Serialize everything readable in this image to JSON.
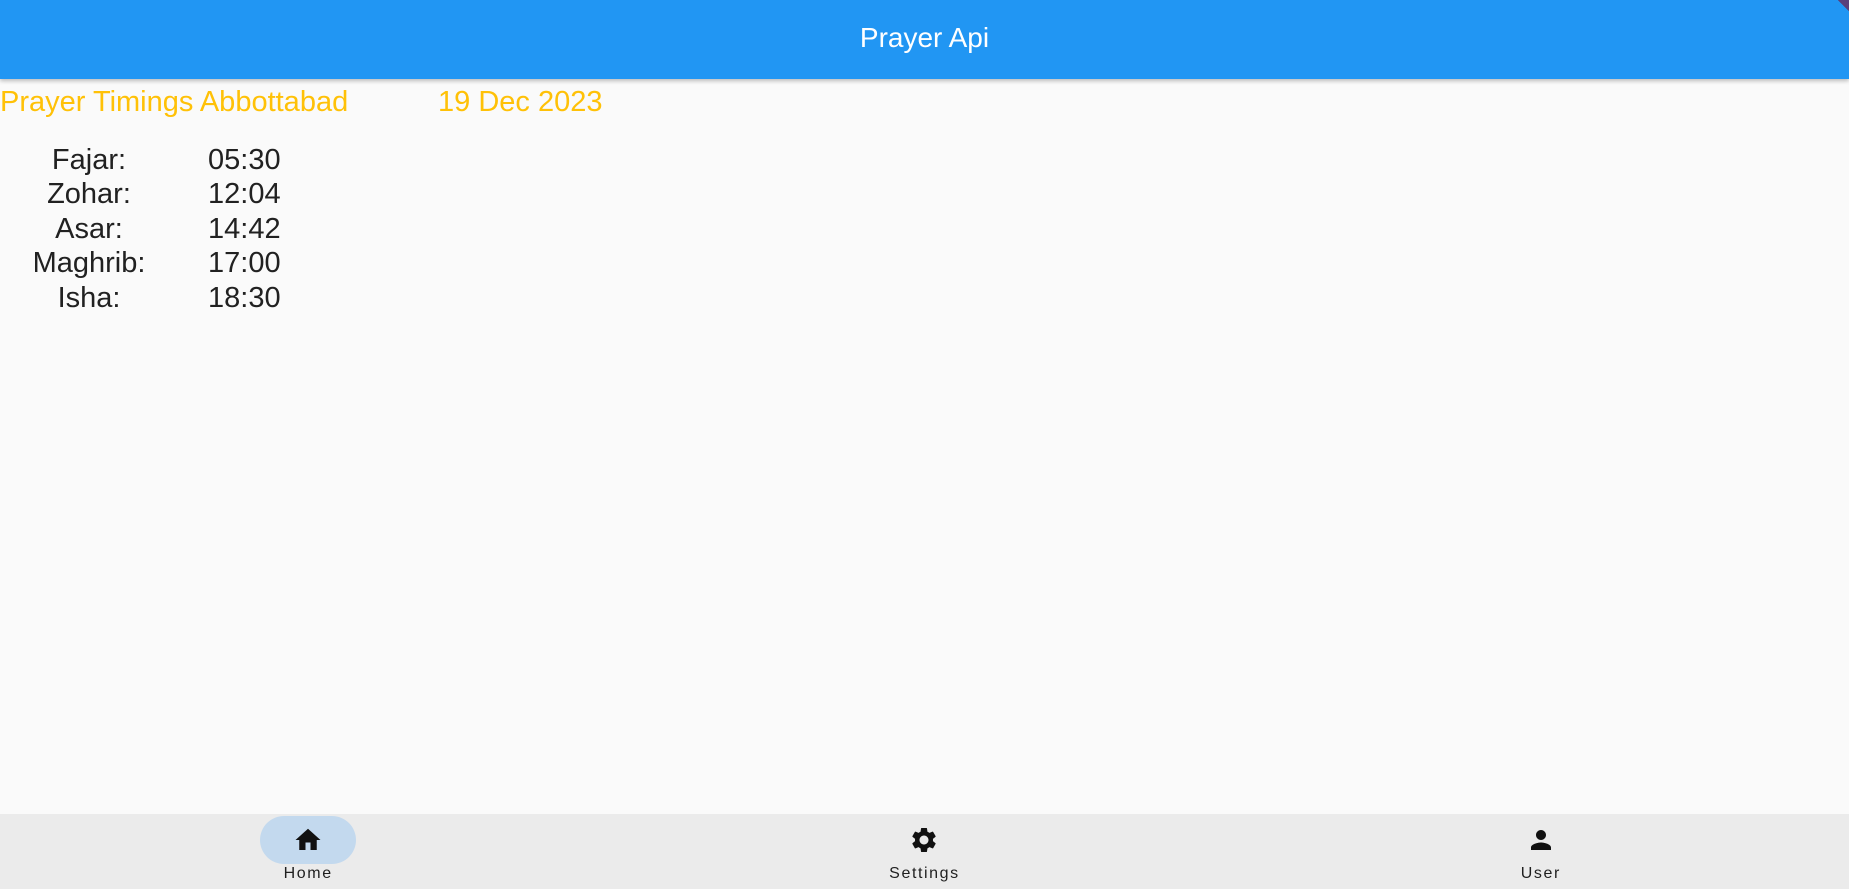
{
  "appbar": {
    "title": "Prayer Api",
    "background": "#2196f3"
  },
  "header": {
    "title": "Prayer Timings Abbottabad",
    "date": "19 Dec 2023",
    "color": "#ffc107"
  },
  "timings": [
    {
      "name": "Fajar:",
      "time": "05:30"
    },
    {
      "name": "Zohar:",
      "time": "12:04"
    },
    {
      "name": "Asar:",
      "time": "14:42"
    },
    {
      "name": "Maghrib:",
      "time": "17:00"
    },
    {
      "name": "Isha:",
      "time": "18:30"
    }
  ],
  "bottom_nav": {
    "items": [
      {
        "label": "Home",
        "icon": "home-icon",
        "active": true
      },
      {
        "label": "Settings",
        "icon": "gear-icon",
        "active": false
      },
      {
        "label": "User",
        "icon": "person-icon",
        "active": false
      }
    ],
    "active_indicator_color": "#c3d9ee",
    "background": "#ebebeb"
  }
}
